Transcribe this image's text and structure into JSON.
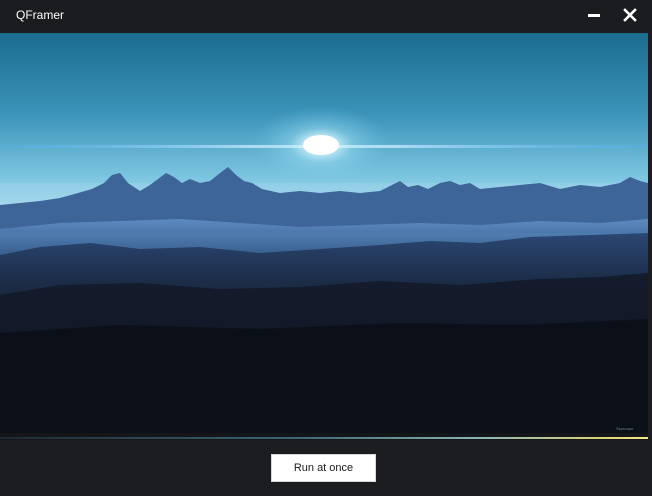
{
  "window": {
    "title": "QFramer",
    "minimize_icon": "minimize-icon",
    "close_icon": "close-icon"
  },
  "banner": {
    "watermark": "Skyscape"
  },
  "progress": {
    "fraction": 1.0,
    "colors": {
      "start": "#1d2a33",
      "end": "#f3e78a"
    }
  },
  "actions": {
    "run_label": "Run at once"
  },
  "colors": {
    "background": "#1c1d21",
    "title_text": "#ffffff",
    "button_bg": "#ffffff"
  }
}
